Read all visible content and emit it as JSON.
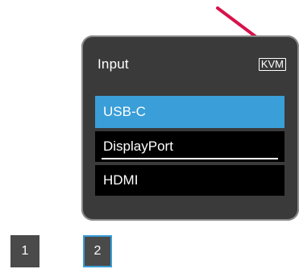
{
  "osd": {
    "title": "Input",
    "kvm_badge": "KVM",
    "items": [
      {
        "label": "USB-C",
        "state": "selected"
      },
      {
        "label": "DisplayPort",
        "state": "underlined"
      },
      {
        "label": "HDMI",
        "state": "normal"
      }
    ]
  },
  "pages": [
    {
      "label": "1",
      "active": false
    },
    {
      "label": "2",
      "active": true
    }
  ],
  "colors": {
    "panel_bg": "#3a3a3a",
    "panel_border": "#8a8a8a",
    "selected_bg": "#3a9ed8",
    "item_bg": "#000000",
    "arrow": "#d8124b",
    "button_bg": "#4a4a4a"
  },
  "icons": {
    "pointer_arrow": "arrow-icon"
  }
}
